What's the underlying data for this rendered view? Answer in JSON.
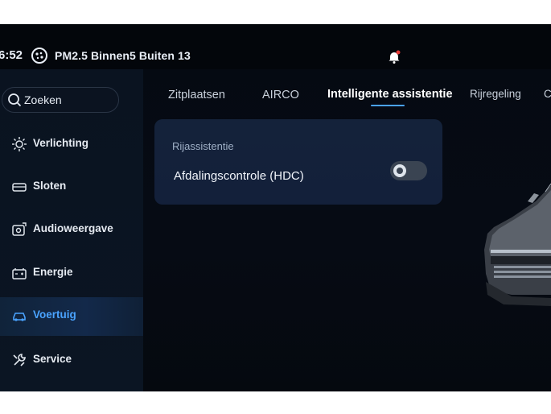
{
  "status": {
    "time": "6:52",
    "pm_label": "PM2.5",
    "indoor_label": "Binnen",
    "indoor_value": "5",
    "outdoor_label": "Buiten",
    "outdoor_value": "13",
    "pm_icon": "air-quality-icon",
    "notification_icon": "notification-bell-icon"
  },
  "sidebar": {
    "search_label": "Zoeken",
    "items": [
      {
        "label": "Verlichting",
        "icon": "light-icon"
      },
      {
        "label": "Sloten",
        "icon": "lock-icon"
      },
      {
        "label": "Audioweergave",
        "icon": "audio-icon"
      },
      {
        "label": "Energie",
        "icon": "battery-icon"
      },
      {
        "label": "Voertuig",
        "icon": "car-icon"
      },
      {
        "label": "Service",
        "icon": "wrench-icon"
      }
    ],
    "active_index": 4
  },
  "tabs": [
    {
      "label": "Zitplaatsen"
    },
    {
      "label": "AIRCO"
    },
    {
      "label": "Intelligente assistentie"
    },
    {
      "label": "Rijregeling"
    },
    {
      "label": "C"
    }
  ],
  "active_tab": 2,
  "card": {
    "section_title": "Rijassistentie",
    "hdc_label": "Afdalingscontrole (HDC)",
    "hdc_enabled": false
  },
  "colors": {
    "accent": "#4aa3ff",
    "background": "#050a12",
    "card": "#14223a",
    "notification_dot": "#e53935"
  }
}
